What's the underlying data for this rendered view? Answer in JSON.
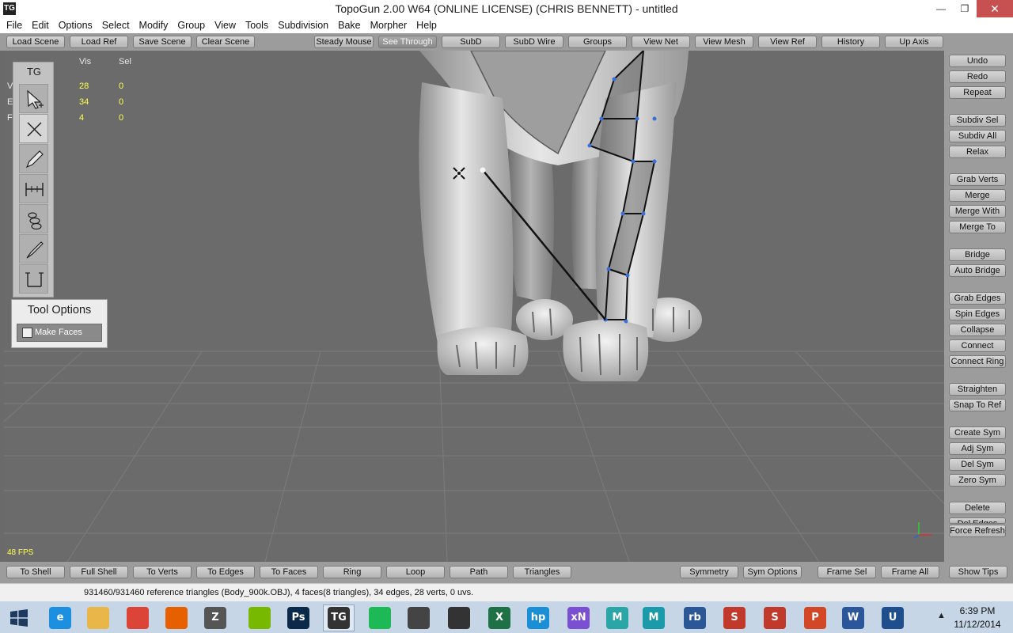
{
  "window": {
    "title": "TopoGun 2.00 W64  (ONLINE LICENSE) (CHRIS BENNETT) - untitled",
    "app_icon": "TG",
    "controls": [
      "minimize-icon",
      "maximize-icon",
      "close-icon"
    ]
  },
  "menu": [
    "File",
    "Edit",
    "Options",
    "Select",
    "Modify",
    "Group",
    "View",
    "Tools",
    "Subdivision",
    "Bake",
    "Morpher",
    "Help"
  ],
  "top_toolbar": [
    "Load Scene",
    "Load Ref",
    "Save Scene",
    "Clear Scene",
    "Steady Mouse",
    "See Through",
    "SubD",
    "SubD Wire",
    "Groups",
    "View Net",
    "View Mesh",
    "View Ref",
    "History",
    "Up Axis"
  ],
  "stats": {
    "headers": [
      "Vis",
      "Sel"
    ],
    "rows": [
      {
        "label": "V",
        "vis": "28",
        "sel": "0"
      },
      {
        "label": "E",
        "vis": "34",
        "sel": "0"
      },
      {
        "label": "F",
        "vis": "4",
        "sel": "0"
      }
    ]
  },
  "tool_palette": {
    "title": "TG",
    "tools": [
      "select-arrow-icon",
      "create-x-icon",
      "draw-pencil-icon",
      "bridge-tool-icon",
      "tubes-tool-icon",
      "brush-icon",
      "edge-tool-icon"
    ]
  },
  "tool_options": {
    "title": "Tool Options",
    "make_faces_label": "Make Faces",
    "make_faces_checked": false
  },
  "viewport": {
    "fps": "48 FPS"
  },
  "right_panel": [
    "Undo",
    "Redo",
    "Repeat",
    "Subdiv Sel",
    "Subdiv All",
    "Relax",
    "Grab Verts",
    "Merge",
    "Merge With",
    "Merge To",
    "Bridge",
    "Auto Bridge",
    "Grab Edges",
    "Spin Edges",
    "Collapse",
    "Connect",
    "Connect Ring",
    "Straighten",
    "Snap To Ref",
    "Create Sym",
    "Adj Sym",
    "Del Sym",
    "Zero Sym",
    "Delete",
    "Del Edges",
    "Force Refresh"
  ],
  "bottom_toolbar": [
    "To Shell",
    "Full Shell",
    "To Verts",
    "To Edges",
    "To Faces",
    "Ring",
    "Loop",
    "Path",
    "Triangles",
    "Symmetry",
    "Sym Options",
    "Frame Sel",
    "Frame All",
    "Show Tips"
  ],
  "status_bar": "931460/931460 reference triangles (Body_900k.OBJ), 4 faces(8 triangles), 34 edges, 28 verts, 0 uvs.",
  "taskbar": {
    "apps": [
      {
        "name": "ie-icon",
        "glyph": "e",
        "color": "#1c8fe0"
      },
      {
        "name": "file-explorer-icon",
        "glyph": "",
        "color": "#e9b64a"
      },
      {
        "name": "chrome-icon",
        "glyph": "",
        "color": "#db4437"
      },
      {
        "name": "firefox-icon",
        "glyph": "",
        "color": "#e66000"
      },
      {
        "name": "zbrush-icon",
        "glyph": "Z",
        "color": "#555555"
      },
      {
        "name": "nvidia-icon",
        "glyph": "",
        "color": "#76b900"
      },
      {
        "name": "photoshop-icon",
        "glyph": "Ps",
        "color": "#0b2a4a"
      },
      {
        "name": "topogun-icon",
        "glyph": "TG",
        "color": "#333333"
      },
      {
        "name": "spotify-icon",
        "glyph": "",
        "color": "#1db954"
      },
      {
        "name": "unity-icon",
        "glyph": "",
        "color": "#444444"
      },
      {
        "name": "mudbox-icon",
        "glyph": "",
        "color": "#333333"
      },
      {
        "name": "excel-icon",
        "glyph": "X",
        "color": "#1e7145"
      },
      {
        "name": "hp-icon",
        "glyph": "hp",
        "color": "#1a8fd6"
      },
      {
        "name": "xnormal-icon",
        "glyph": "xN",
        "color": "#7b4fd1"
      },
      {
        "name": "maya-lt-icon",
        "glyph": "M",
        "color": "#2aa6a6"
      },
      {
        "name": "maya-icon",
        "glyph": "M",
        "color": "#1b9aaa"
      },
      {
        "name": "rb-icon",
        "glyph": "rb",
        "color": "#2b5797"
      },
      {
        "name": "substance-icon",
        "glyph": "S",
        "color": "#c0392b"
      },
      {
        "name": "substance-2-icon",
        "glyph": "S",
        "color": "#c0392b"
      },
      {
        "name": "powerpoint-icon",
        "glyph": "P",
        "color": "#d24726"
      },
      {
        "name": "word-icon",
        "glyph": "W",
        "color": "#2b579a"
      },
      {
        "name": "unreal-icon",
        "glyph": "U",
        "color": "#1f4e8c"
      }
    ],
    "time": "6:39 PM",
    "date": "11/12/2014"
  }
}
